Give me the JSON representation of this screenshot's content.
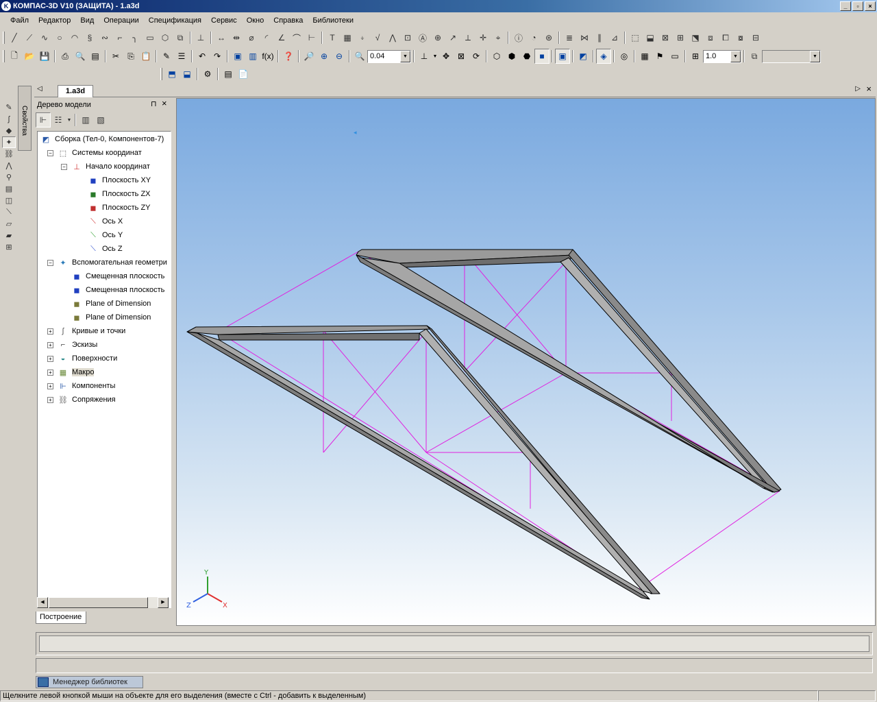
{
  "window": {
    "title": "КОМПАС-3D V10 (ЗАЩИТА) - 1.a3d",
    "app_icon": "K",
    "minimize": "_",
    "restore": "▫",
    "close": "×"
  },
  "menu": [
    "Файл",
    "Редактор",
    "Вид",
    "Операции",
    "Спецификация",
    "Сервис",
    "Окно",
    "Справка",
    "Библиотеки"
  ],
  "toolbar": {
    "zoom_value": "0.04",
    "step_value": "1.0",
    "fx_label": "f(x)"
  },
  "side_tab": {
    "label": "Свойства"
  },
  "document": {
    "tab": "1.a3d",
    "nav_left": "◁",
    "nav_right": "▷",
    "close": "×"
  },
  "tree": {
    "title": "Дерево модели",
    "pin": "⊓",
    "close": "×",
    "bottom_tab": "Построение",
    "items": [
      {
        "label": "Сборка (Тел-0, Компонентов-7)",
        "icon": "assembly-icon",
        "level": 0,
        "expander": ""
      },
      {
        "label": "Системы координат",
        "icon": "coordinate-systems-icon",
        "level": 1,
        "expander": "−"
      },
      {
        "label": "Начало координат",
        "icon": "origin-icon",
        "level": 2,
        "expander": "−"
      },
      {
        "label": "Плоскость XY",
        "icon": "plane-xy-icon",
        "level": 3,
        "expander": ""
      },
      {
        "label": "Плоскость ZX",
        "icon": "plane-zx-icon",
        "level": 3,
        "expander": ""
      },
      {
        "label": "Плоскость ZY",
        "icon": "plane-zy-icon",
        "level": 3,
        "expander": ""
      },
      {
        "label": "Ось X",
        "icon": "axis-x-icon",
        "level": 3,
        "expander": ""
      },
      {
        "label": "Ось Y",
        "icon": "axis-y-icon",
        "level": 3,
        "expander": ""
      },
      {
        "label": "Ось Z",
        "icon": "axis-z-icon",
        "level": 3,
        "expander": ""
      },
      {
        "label": "Вспомогательная геометри",
        "icon": "auxiliary-geometry-icon",
        "level": 1,
        "expander": "−"
      },
      {
        "label": "Смещенная плоскость",
        "icon": "offset-plane-icon",
        "level": 2,
        "expander": ""
      },
      {
        "label": "Смещенная плоскость",
        "icon": "offset-plane-icon",
        "level": 2,
        "expander": ""
      },
      {
        "label": "Plane of Dimension",
        "icon": "plane-of-dimension-icon",
        "level": 2,
        "expander": ""
      },
      {
        "label": "Plane of Dimension",
        "icon": "plane-of-dimension-icon",
        "level": 2,
        "expander": ""
      },
      {
        "label": "Кривые и точки",
        "icon": "curves-icon",
        "level": 1,
        "expander": "+"
      },
      {
        "label": "Эскизы",
        "icon": "sketches-icon",
        "level": 1,
        "expander": "+"
      },
      {
        "label": "Поверхности",
        "icon": "surfaces-icon",
        "level": 1,
        "expander": "+"
      },
      {
        "label": "Макро",
        "icon": "macro-icon",
        "level": 1,
        "expander": "+"
      },
      {
        "label": "Компоненты",
        "icon": "components-icon",
        "level": 1,
        "expander": "+"
      },
      {
        "label": "Сопряжения",
        "icon": "mates-icon",
        "level": 1,
        "expander": "+"
      }
    ]
  },
  "triad": {
    "x": "X",
    "y": "Y",
    "z": "Z"
  },
  "library_manager": "Менеджер библиотек",
  "status": {
    "message": "Щелкните левой кнопкой мыши на объекте для его выделения (вместе с Ctrl - добавить к выделенным)",
    "right": ""
  },
  "colors": {
    "model_edge": "#000000",
    "model_face": "#8c8c8c",
    "construction_lines": "#e020e0",
    "axis_x": "#e03030",
    "axis_y": "#30a030",
    "axis_z": "#3060e0"
  }
}
